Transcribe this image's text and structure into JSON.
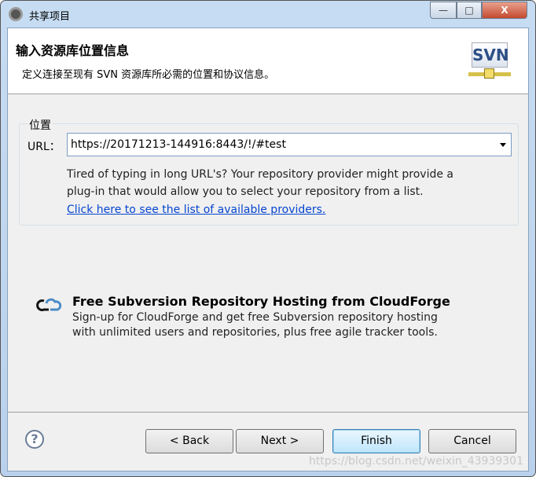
{
  "window": {
    "title": "共享项目",
    "minimize": "—",
    "maximize": "□",
    "close": "X"
  },
  "header": {
    "title": "输入资源库位置信息",
    "description": "定义连接至现有 SVN 资源库所必需的位置和协议信息。",
    "logo_text": "SVN"
  },
  "location": {
    "legend": "位置",
    "url_label": "URL：",
    "url_value": "https://20171213-144916:8443/!/#test",
    "hint_lines": [
      "Tired of typing in long URL's?  Your repository provider might provide a",
      "plug-in that would allow you to select your repository from a list."
    ],
    "link": "Click here to see the list of available providers."
  },
  "cloudforge": {
    "icon": "cloud-icon",
    "title": "Free Subversion Repository Hosting from CloudForge",
    "lines": [
      "Sign-up for CloudForge and get free Subversion repository hosting",
      "with unlimited users and repositories, plus free agile tracker tools."
    ]
  },
  "footer": {
    "help": "?",
    "back": "< Back",
    "next": "Next >",
    "finish": "Finish",
    "cancel": "Cancel"
  },
  "watermark": "https://blog.csdn.net/weixin_43939301"
}
